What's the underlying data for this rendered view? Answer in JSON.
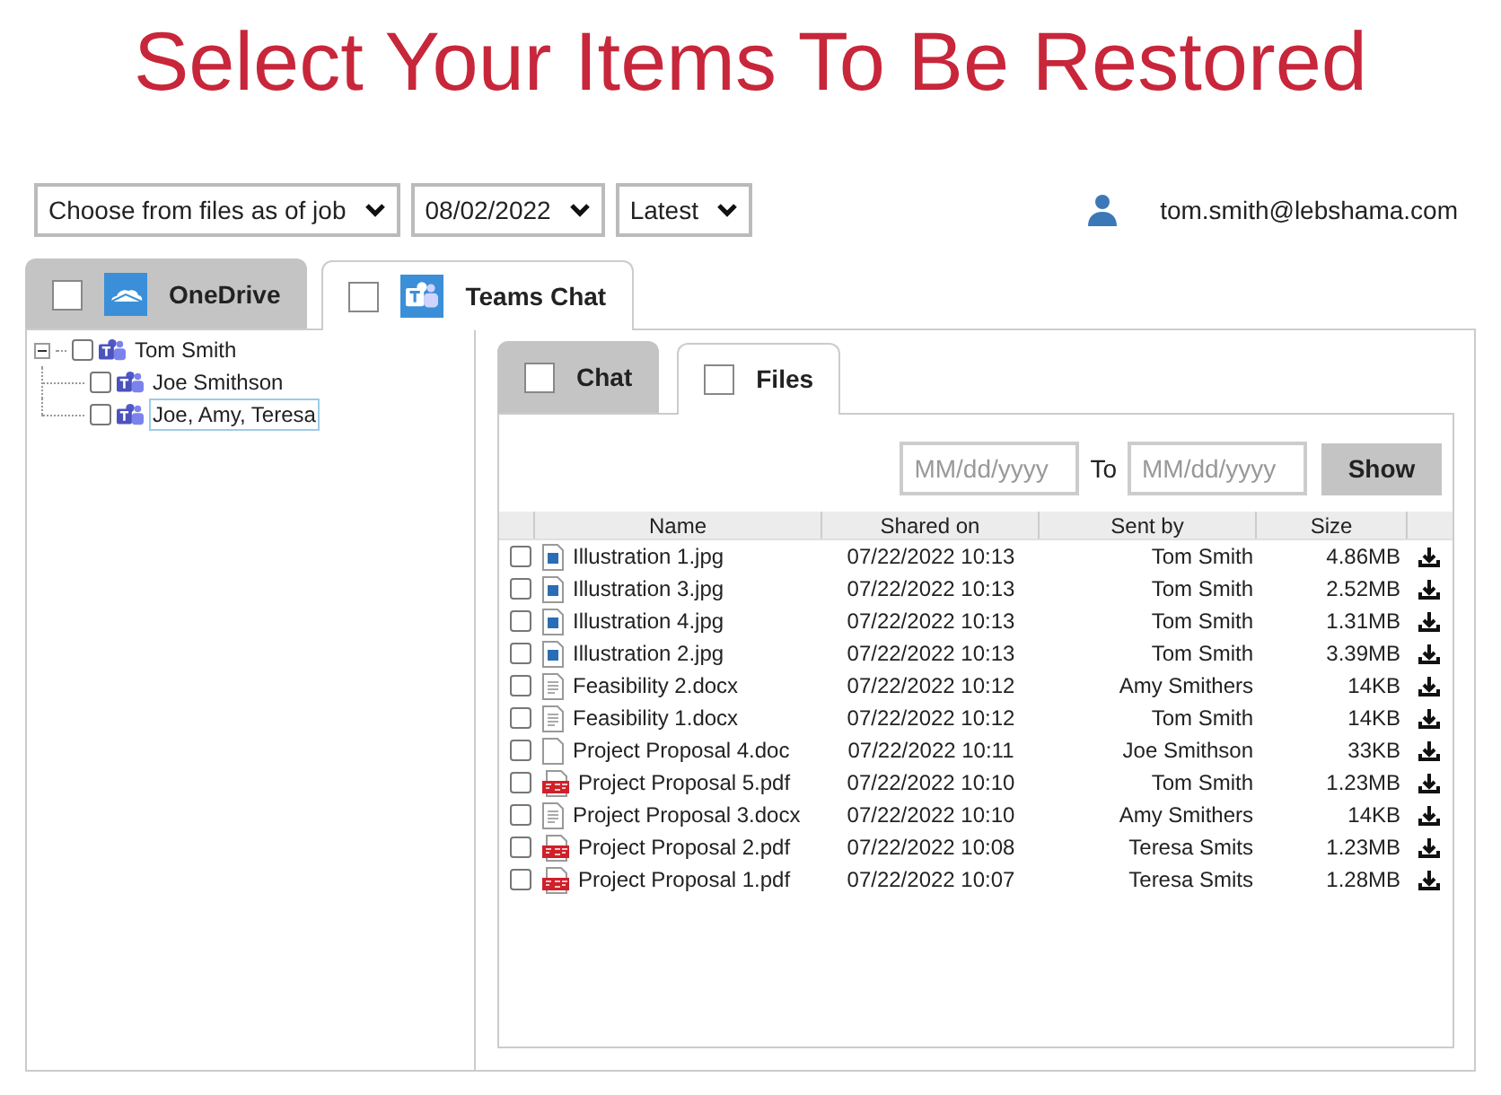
{
  "title": "Select Your Items To Be Restored",
  "filters": [
    {
      "value": "Choose from files as of job"
    },
    {
      "value": "08/02/2022"
    },
    {
      "value": "Latest"
    }
  ],
  "user": {
    "email": "tom.smith@lebshama.com"
  },
  "tabs": [
    {
      "label": "OneDrive",
      "kind": "onedrive",
      "selected": false,
      "checked": false
    },
    {
      "label": "Teams Chat",
      "kind": "teams",
      "selected": true,
      "checked": false
    }
  ],
  "tree": [
    {
      "label": "Tom Smith",
      "checked": false,
      "expanded": true,
      "selected": false,
      "children": [
        {
          "label": "Joe Smithson",
          "checked": false,
          "selected": false
        },
        {
          "label": "Joe, Amy, Teresa",
          "checked": false,
          "selected": true
        }
      ]
    }
  ],
  "subtabs": [
    {
      "label": "Chat",
      "selected": false,
      "checked": false
    },
    {
      "label": "Files",
      "selected": true,
      "checked": false
    }
  ],
  "date_filter": {
    "from_placeholder": "MM/dd/yyyy",
    "to_label": "To",
    "to_placeholder": "MM/dd/yyyy",
    "button": "Show"
  },
  "table": {
    "columns": [
      "Name",
      "Shared on",
      "Sent by",
      "Size"
    ],
    "rows": [
      {
        "kind": "image",
        "name": "Illustration 1.jpg",
        "shared_on": "07/22/2022 10:13",
        "sent_by": "Tom Smith",
        "size": "4.86MB",
        "checked": false
      },
      {
        "kind": "image",
        "name": "Illustration 3.jpg",
        "shared_on": "07/22/2022 10:13",
        "sent_by": "Tom Smith",
        "size": "2.52MB",
        "checked": false
      },
      {
        "kind": "image",
        "name": "Illustration 4.jpg",
        "shared_on": "07/22/2022 10:13",
        "sent_by": "Tom Smith",
        "size": "1.31MB",
        "checked": false
      },
      {
        "kind": "image",
        "name": "Illustration 2.jpg",
        "shared_on": "07/22/2022 10:13",
        "sent_by": "Tom Smith",
        "size": "3.39MB",
        "checked": false
      },
      {
        "kind": "document",
        "name": "Feasibility 2.docx",
        "shared_on": "07/22/2022 10:12",
        "sent_by": "Amy Smithers",
        "size": "14KB",
        "checked": false
      },
      {
        "kind": "document",
        "name": "Feasibility 1.docx",
        "shared_on": "07/22/2022 10:12",
        "sent_by": "Tom Smith",
        "size": "14KB",
        "checked": false
      },
      {
        "kind": "blank",
        "name": "Project Proposal 4.doc",
        "shared_on": "07/22/2022 10:11",
        "sent_by": "Joe Smithson",
        "size": "33KB",
        "checked": false
      },
      {
        "kind": "pdf",
        "name": "Project Proposal 5.pdf",
        "shared_on": "07/22/2022 10:10",
        "sent_by": "Tom Smith",
        "size": "1.23MB",
        "checked": false
      },
      {
        "kind": "document",
        "name": "Project Proposal 3.docx",
        "shared_on": "07/22/2022 10:10",
        "sent_by": "Amy Smithers",
        "size": "14KB",
        "checked": false
      },
      {
        "kind": "pdf",
        "name": "Project Proposal 2.pdf",
        "shared_on": "07/22/2022 10:08",
        "sent_by": "Teresa Smits",
        "size": "1.23MB",
        "checked": false
      },
      {
        "kind": "pdf",
        "name": "Project Proposal 1.pdf",
        "shared_on": "07/22/2022 10:07",
        "sent_by": "Teresa Smits",
        "size": "1.28MB",
        "checked": false
      }
    ]
  }
}
